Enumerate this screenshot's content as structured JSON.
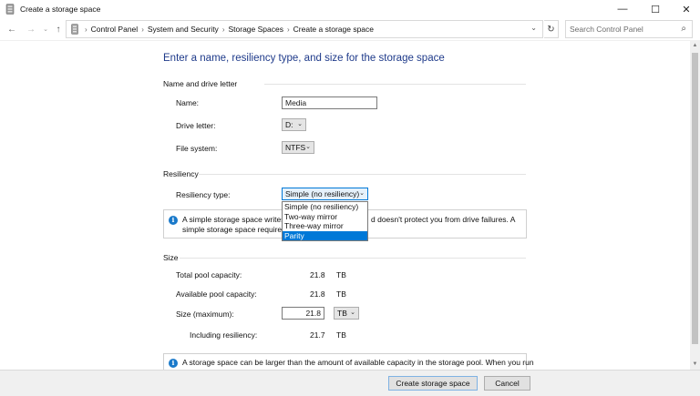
{
  "window": {
    "title": "Create a storage space",
    "minimize_glyph": "—",
    "maximize_glyph": "☐",
    "close_glyph": "✕"
  },
  "nav": {
    "back_glyph": "←",
    "forward_glyph": "→",
    "recent_glyph": "⌄",
    "up_glyph": "↑",
    "breadcrumbs": [
      "Control Panel",
      "System and Security",
      "Storage Spaces",
      "Create a storage space"
    ],
    "separator": "›",
    "dropdown_glyph": "⌄",
    "refresh_glyph": "↻",
    "search_placeholder": "Search Control Panel",
    "search_glyph": "⌕"
  },
  "page": {
    "heading": "Enter a name, resiliency type, and size for the storage space",
    "name_section": {
      "title": "Name and drive letter",
      "name_label": "Name:",
      "name_value": "Media",
      "drive_letter_label": "Drive letter:",
      "drive_letter_value": "D:",
      "file_system_label": "File system:",
      "file_system_value": "NTFS"
    },
    "resiliency_section": {
      "title": "Resiliency",
      "type_label": "Resiliency type:",
      "type_value": "Simple (no resiliency)",
      "info_line1_left": "A simple storage space writes",
      "info_line1_right": "d doesn't protect you from drive failures. A",
      "info_line2": "simple storage space requires",
      "dropdown_options": [
        "Simple (no resiliency)",
        "Two-way mirror",
        "Three-way mirror",
        "Parity"
      ],
      "highlighted_option": "Parity"
    },
    "size_section": {
      "title": "Size",
      "total_label": "Total pool capacity:",
      "total_value": "21.8",
      "total_unit": "TB",
      "available_label": "Available pool capacity:",
      "available_value": "21.8",
      "available_unit": "TB",
      "size_label": "Size (maximum):",
      "size_value": "21.8",
      "size_unit": "TB",
      "including_label": "Including resiliency:",
      "including_value": "21.7",
      "including_unit": "TB",
      "info_text": "A storage space can be larger than the amount of available capacity in the storage pool. When you run"
    }
  },
  "footer": {
    "create_label": "Create storage space",
    "cancel_label": "Cancel"
  },
  "colors": {
    "heading": "#1e3a8a",
    "info_icon": "#1979ca",
    "selection": "#0078d7"
  }
}
